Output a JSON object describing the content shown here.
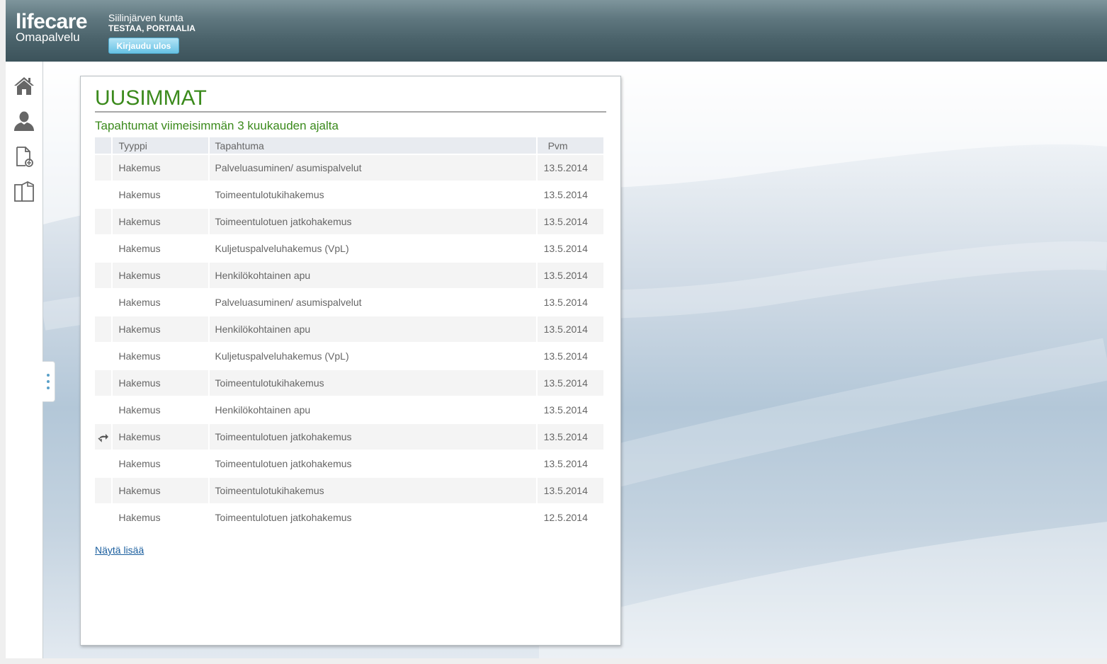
{
  "header": {
    "brand": "lifecare",
    "product": "Omapalvelu",
    "organization": "Siilinjärven kunta",
    "user": "TESTAA, PORTAALIA",
    "logout_label": "Kirjaudu ulos"
  },
  "nav": {
    "items": [
      {
        "name": "home",
        "icon": "home-icon"
      },
      {
        "name": "profile",
        "icon": "user-icon"
      },
      {
        "name": "new-document",
        "icon": "new-document-icon"
      },
      {
        "name": "documents",
        "icon": "documents-icon"
      }
    ]
  },
  "panel": {
    "title": "UUSIMMAT",
    "subtitle": "Tapahtumat viimeisimmän 3 kuukauden ajalta",
    "columns": {
      "type": "Tyyppi",
      "event": "Tapahtuma",
      "date": "Pvm"
    },
    "rows": [
      {
        "icon": "",
        "type": "Hakemus",
        "event": "Palveluasuminen/ asumispalvelut",
        "date": "13.5.2014"
      },
      {
        "icon": "",
        "type": "Hakemus",
        "event": "Toimeentulotukihakemus",
        "date": "13.5.2014"
      },
      {
        "icon": "",
        "type": "Hakemus",
        "event": "Toimeentulotuen jatkohakemus",
        "date": "13.5.2014"
      },
      {
        "icon": "",
        "type": "Hakemus",
        "event": "Kuljetuspalveluhakemus (VpL)",
        "date": "13.5.2014"
      },
      {
        "icon": "",
        "type": "Hakemus",
        "event": "Henkilökohtainen apu",
        "date": "13.5.2014"
      },
      {
        "icon": "",
        "type": "Hakemus",
        "event": "Palveluasuminen/ asumispalvelut",
        "date": "13.5.2014"
      },
      {
        "icon": "",
        "type": "Hakemus",
        "event": "Henkilökohtainen apu",
        "date": "13.5.2014"
      },
      {
        "icon": "",
        "type": "Hakemus",
        "event": "Kuljetuspalveluhakemus (VpL)",
        "date": "13.5.2014"
      },
      {
        "icon": "",
        "type": "Hakemus",
        "event": "Toimeentulotukihakemus",
        "date": "13.5.2014"
      },
      {
        "icon": "",
        "type": "Hakemus",
        "event": "Henkilökohtainen apu",
        "date": "13.5.2014"
      },
      {
        "icon": "reply-icon",
        "type": "Hakemus",
        "event": "Toimeentulotuen jatkohakemus",
        "date": "13.5.2014"
      },
      {
        "icon": "",
        "type": "Hakemus",
        "event": "Toimeentulotuen jatkohakemus",
        "date": "13.5.2014"
      },
      {
        "icon": "",
        "type": "Hakemus",
        "event": "Toimeentulotukihakemus",
        "date": "13.5.2014"
      },
      {
        "icon": "",
        "type": "Hakemus",
        "event": "Toimeentulotuen jatkohakemus",
        "date": "12.5.2014"
      }
    ],
    "show_more_label": "Näytä lisää"
  },
  "colors": {
    "accent_green": "#3b8a1c",
    "header_dark": "#3c535b",
    "link_blue": "#1a5e9e",
    "button_blue": "#67c2e4"
  }
}
